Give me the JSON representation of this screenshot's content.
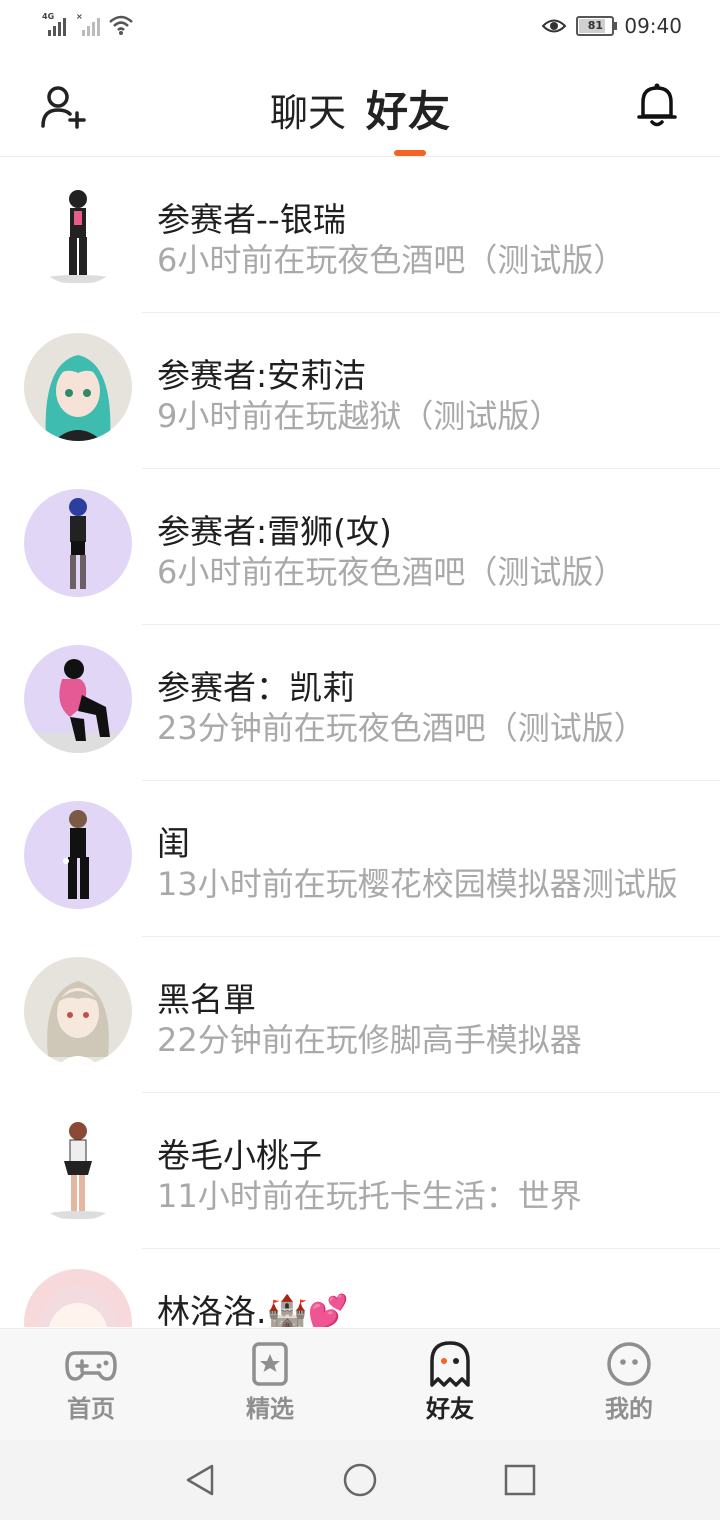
{
  "status_bar": {
    "network_label": "4G",
    "time": "09:40",
    "battery": "81",
    "icons": [
      "signal-icon",
      "wifi-icon",
      "eye-icon",
      "battery-icon"
    ]
  },
  "header": {
    "tabs": [
      {
        "label": "聊天",
        "active": false
      },
      {
        "label": "好友",
        "active": true
      }
    ],
    "accent_color": "#f26522"
  },
  "friends": [
    {
      "name": "参赛者--银瑞",
      "status": "6小时前在玩夜色酒吧（测试版）",
      "avatar_bg": "white"
    },
    {
      "name": "参赛者:安莉洁",
      "status": "9小时前在玩越狱（测试版）",
      "avatar_bg": "grey"
    },
    {
      "name": "参赛者:雷狮(攻)",
      "status": "6小时前在玩夜色酒吧（测试版）",
      "avatar_bg": "purple"
    },
    {
      "name": "参赛者：凯莉",
      "status": "23分钟前在玩夜色酒吧（测试版）",
      "avatar_bg": "purple"
    },
    {
      "name": "闺",
      "status": "13小时前在玩樱花校园模拟器测试版",
      "avatar_bg": "purple"
    },
    {
      "name": "黑名單",
      "status": "22分钟前在玩修脚高手模拟器",
      "avatar_bg": "grey"
    },
    {
      "name": "卷毛小桃子",
      "status": "11小时前在玩托卡生活：世界",
      "avatar_bg": "white"
    },
    {
      "name": "林洛洛.🏰💕",
      "status": "",
      "avatar_bg": "pink"
    }
  ],
  "bottom_nav": [
    {
      "label": "首页",
      "icon": "gamepad-icon",
      "active": false
    },
    {
      "label": "精选",
      "icon": "star-card-icon",
      "active": false
    },
    {
      "label": "好友",
      "icon": "ghost-icon",
      "active": true
    },
    {
      "label": "我的",
      "icon": "smiley-icon",
      "active": false
    }
  ]
}
